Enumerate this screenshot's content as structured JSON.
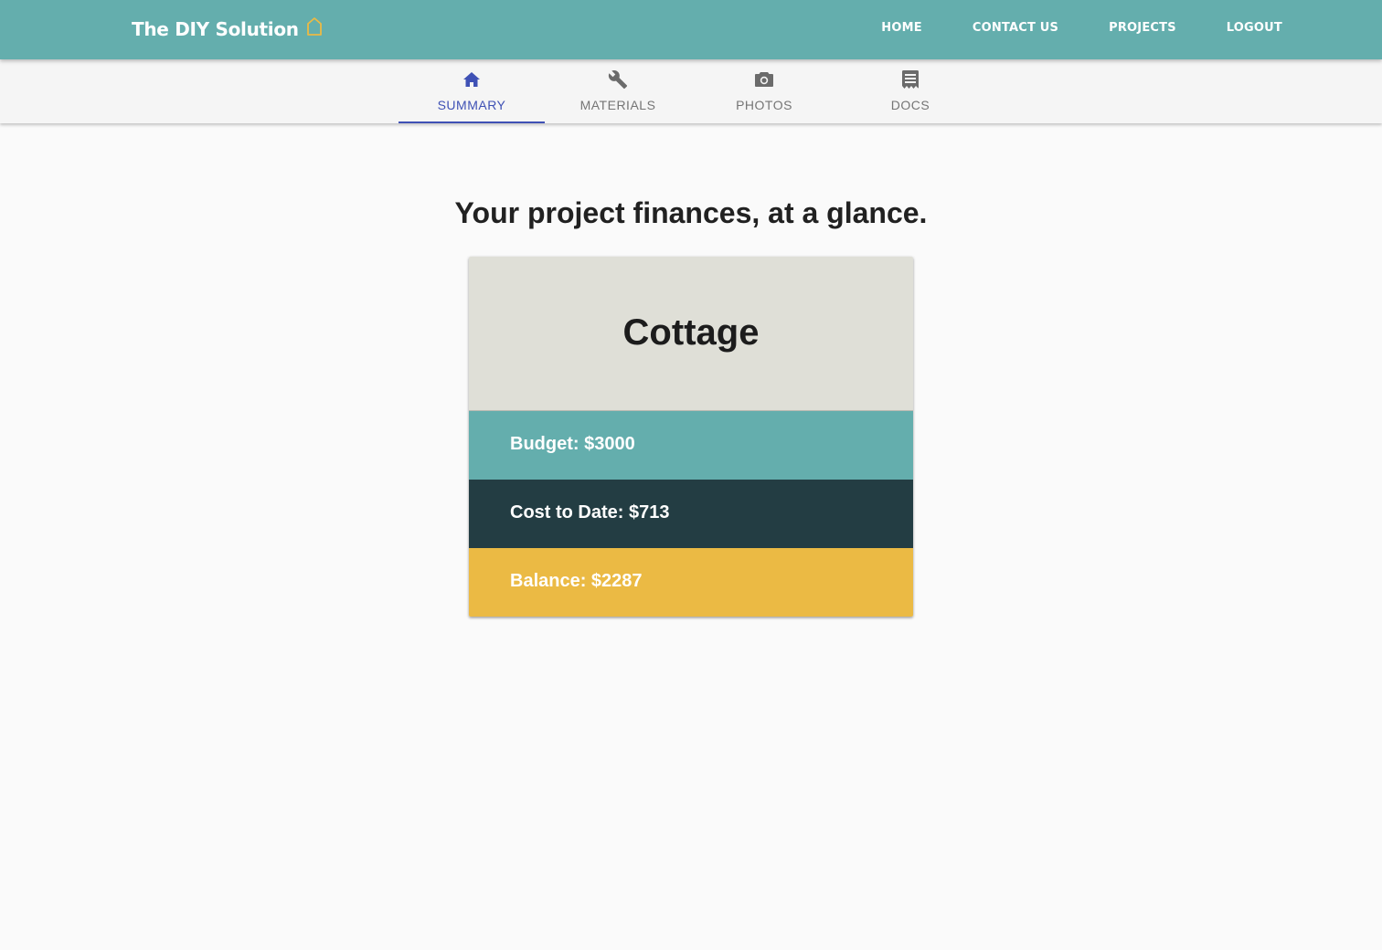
{
  "brand": {
    "name": "The DIY Solution",
    "icon": "house-outline-icon",
    "icon_color": "#ebba44"
  },
  "nav": {
    "links": [
      {
        "label": "HOME"
      },
      {
        "label": "CONTACT US"
      },
      {
        "label": "PROJECTS"
      },
      {
        "label": "LOGOUT"
      }
    ]
  },
  "tabs": [
    {
      "label": "SUMMARY",
      "icon": "home-icon",
      "active": true
    },
    {
      "label": "MATERIALS",
      "icon": "wrench-icon",
      "active": false
    },
    {
      "label": "PHOTOS",
      "icon": "camera-icon",
      "active": false
    },
    {
      "label": "DOCS",
      "icon": "document-icon",
      "active": false
    }
  ],
  "headline": "Your project finances, at a glance.",
  "project": {
    "name": "Cottage",
    "budget_label": "Budget: $3000",
    "cost_label": "Cost to Date: $713",
    "balance_label": "Balance: $2287"
  },
  "colors": {
    "primary": "#64aead",
    "dark": "#233d43",
    "accent": "#ebba44",
    "tab_active": "#3f51b5",
    "header_card": "#dfdfd7"
  }
}
